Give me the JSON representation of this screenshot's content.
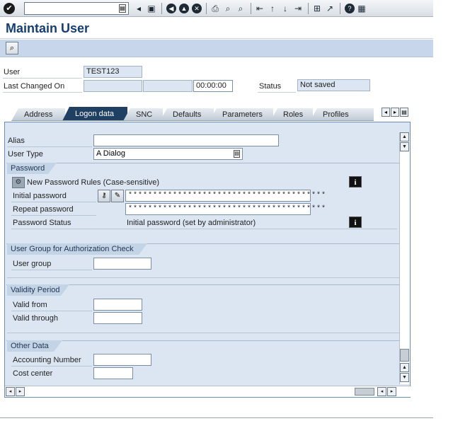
{
  "window": {
    "title": "Maintain User"
  },
  "toolbar": {
    "ok_icon": "enter-icon",
    "command_value": "",
    "icons": [
      "dropdown-icon",
      "back-triangle-icon",
      "save-icon",
      "back-icon",
      "exit-icon",
      "cancel-icon",
      "print-icon",
      "find-icon",
      "find-next-icon",
      "first-page-icon",
      "previous-page-icon",
      "next-page-icon",
      "last-page-icon",
      "create-session-icon",
      "shortcut-icon",
      "help-icon",
      "customize-layout-icon"
    ]
  },
  "app_toolbar": {
    "display_icon": "display-change-icon"
  },
  "header": {
    "user_label": "User",
    "user_value": "TEST123",
    "last_changed_label": "Last Changed On",
    "last_changed_date": "",
    "last_changed_by": "",
    "last_changed_time": "00:00:00",
    "status_label": "Status",
    "status_value": "Not saved"
  },
  "tabs": [
    {
      "label": "Address",
      "active": false
    },
    {
      "label": "Logon data",
      "active": true
    },
    {
      "label": "SNC",
      "active": false
    },
    {
      "label": "Defaults",
      "active": false
    },
    {
      "label": "Parameters",
      "active": false
    },
    {
      "label": "Roles",
      "active": false
    },
    {
      "label": "Profiles",
      "active": false
    }
  ],
  "logon": {
    "alias_label": "Alias",
    "alias_value": "",
    "user_type_label": "User Type",
    "user_type_value": "A Dialog"
  },
  "password": {
    "group_title": "Password",
    "rules_text": "New Password Rules (Case-sensitive)",
    "initial_label": "Initial password",
    "initial_value": "****************************************",
    "repeat_label": "Repeat password",
    "repeat_value": "****************************************",
    "status_label": "Password Status",
    "status_value": "Initial password (set by administrator)"
  },
  "auth_group": {
    "group_title": "User Group for Authorization Check",
    "user_group_label": "User group",
    "user_group_value": ""
  },
  "validity": {
    "group_title": "Validity Period",
    "valid_from_label": "Valid from",
    "valid_from_value": "",
    "valid_through_label": "Valid through",
    "valid_through_value": ""
  },
  "other": {
    "group_title": "Other Data",
    "accounting_label": "Accounting Number",
    "accounting_value": "",
    "cost_center_label": "Cost center",
    "cost_center_value": ""
  },
  "info_glyph": "i"
}
